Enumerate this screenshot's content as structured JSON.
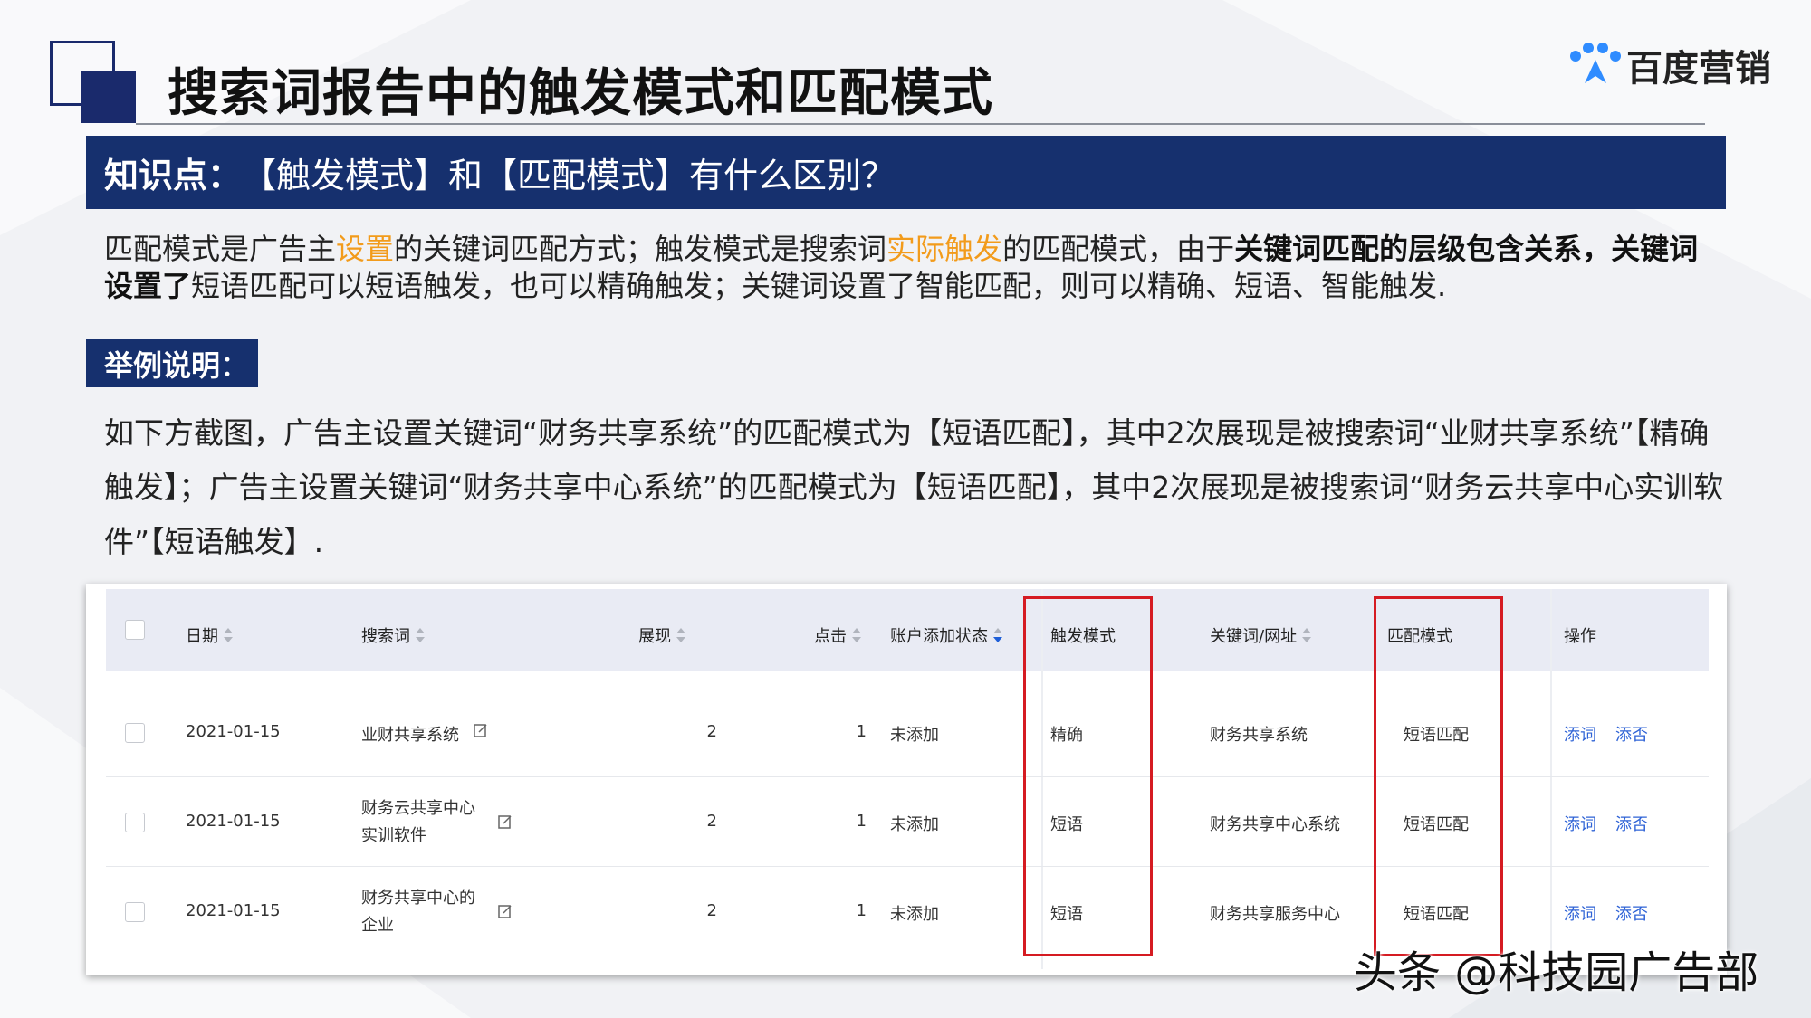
{
  "header": {
    "title": "搜索词报告中的触发模式和匹配模式",
    "brand_name": "百度营销"
  },
  "knowledge": {
    "label": "知识点：",
    "question": "【触发模式】和【匹配模式】有什么区别？",
    "para_parts": [
      "匹配模式是广告主",
      "设置",
      "的关键词匹配方式；触发模式是搜索词",
      "实际触发",
      "的匹配模式，由于",
      "关键词匹配的层级包含关系，关键词设置了",
      "短语匹配可以短语触发，也可以精确触发；关键词设置了智能匹配，则可以精确、短语、智能触发."
    ]
  },
  "example": {
    "label": "举例说明",
    "colon": "：",
    "text": "如下方截图，广告主设置关键词“财务共享系统”的匹配模式为【短语匹配】，其中2次展现是被搜索词“业财共享系统”【精确触发】；广告主设置关键词“财务共享中心系统”的匹配模式为【短语匹配】，其中2次展现是被搜索词“财务云共享中心实训软件”【短语触发】."
  },
  "table": {
    "headers": {
      "date": "日期",
      "term": "搜索词",
      "impressions": "展现",
      "clicks": "点击",
      "status": "账户添加状态",
      "trigger": "触发模式",
      "keyword": "关键词/网址",
      "match": "匹配模式",
      "ops": "操作"
    },
    "rows": [
      {
        "date": "2021-01-15",
        "term": "业财共享系统",
        "impressions": "2",
        "clicks": "1",
        "status": "未添加",
        "trigger": "精确",
        "keyword": "财务共享系统",
        "match": "短语匹配",
        "op1": "添词",
        "op2": "添否"
      },
      {
        "date": "2021-01-15",
        "term": "财务云共享中心实训软件",
        "impressions": "2",
        "clicks": "1",
        "status": "未添加",
        "trigger": "短语",
        "keyword": "财务共享中心系统",
        "match": "短语匹配",
        "op1": "添词",
        "op2": "添否"
      },
      {
        "date": "2021-01-15",
        "term": "财务共享中心的企业",
        "impressions": "2",
        "clicks": "1",
        "status": "未添加",
        "trigger": "短语",
        "keyword": "财务共享服务中心",
        "match": "短语匹配",
        "op1": "添词",
        "op2": "添否"
      }
    ]
  },
  "watermark": "头条 @科技园广告部",
  "colors": {
    "navy": "#16306e",
    "highlight": "#f29b1b",
    "red_box": "#d51b22",
    "link": "#2f63d6"
  }
}
